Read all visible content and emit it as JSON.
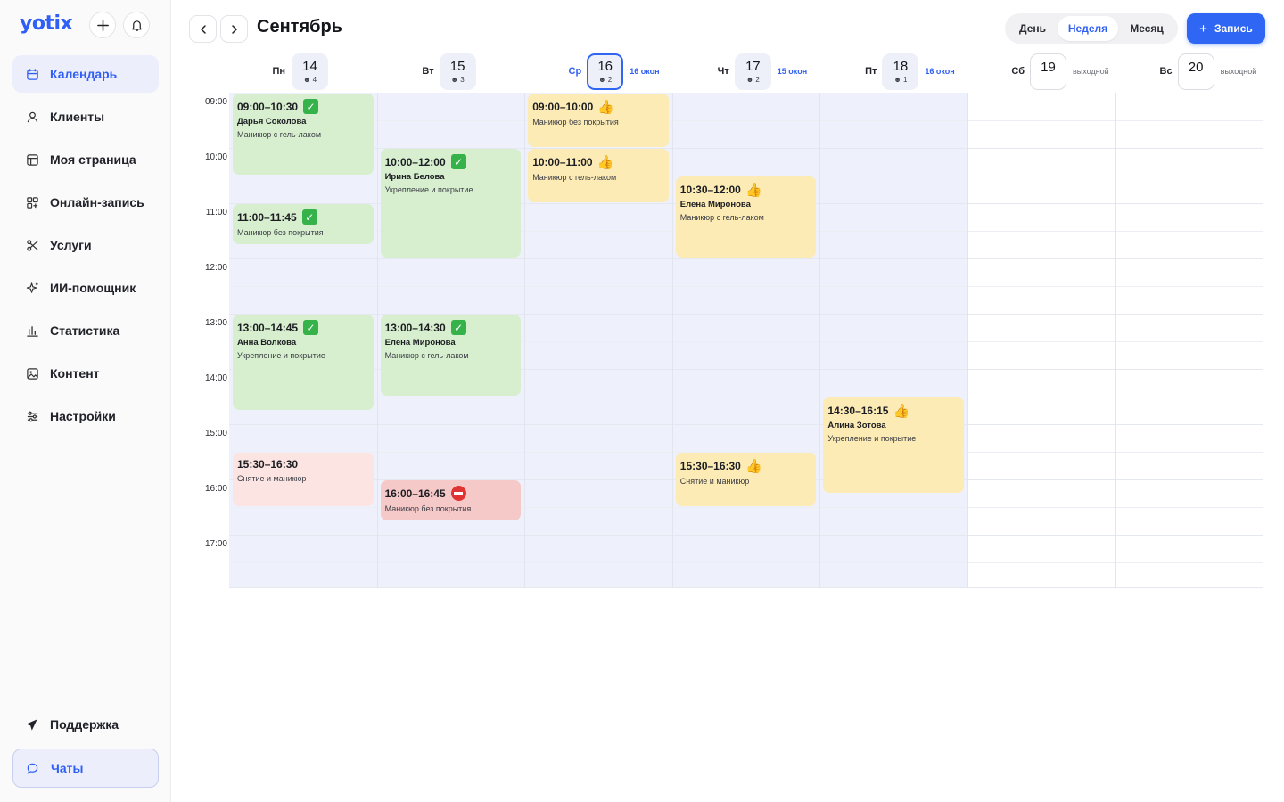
{
  "app": {
    "logo": "yotix"
  },
  "sidebar": {
    "items": [
      {
        "label": "Календарь",
        "icon": "calendar-icon",
        "active": true
      },
      {
        "label": "Клиенты",
        "icon": "person-icon"
      },
      {
        "label": "Моя страница",
        "icon": "page-icon"
      },
      {
        "label": "Онлайн-запись",
        "icon": "grid-plus-icon"
      },
      {
        "label": "Услуги",
        "icon": "scissors-icon"
      },
      {
        "label": "ИИ-помощник",
        "icon": "sparkle-icon"
      },
      {
        "label": "Статистика",
        "icon": "bar-chart-icon"
      },
      {
        "label": "Контент",
        "icon": "image-icon"
      },
      {
        "label": "Настройки",
        "icon": "sliders-icon"
      }
    ],
    "support": "Поддержка",
    "chats": "Чаты"
  },
  "header": {
    "month": "Сентябрь",
    "views": [
      "День",
      "Неделя",
      "Месяц"
    ],
    "active_view": "Неделя",
    "add_label": "Запись"
  },
  "days": [
    {
      "name": "Пн",
      "date": "14",
      "count": "4",
      "extra": ""
    },
    {
      "name": "Вт",
      "date": "15",
      "count": "3",
      "extra": ""
    },
    {
      "name": "Ср",
      "date": "16",
      "count": "2",
      "extra": "16 окон",
      "today": true
    },
    {
      "name": "Чт",
      "date": "17",
      "count": "2",
      "extra": "15 окон"
    },
    {
      "name": "Пт",
      "date": "18",
      "count": "1",
      "extra": "16 окон"
    },
    {
      "name": "Сб",
      "date": "19",
      "count": "",
      "extra": "выходной",
      "off": true
    },
    {
      "name": "Вс",
      "date": "20",
      "count": "",
      "extra": "выходной",
      "off": true
    }
  ],
  "times": [
    "09:00",
    "10:00",
    "11:00",
    "12:00",
    "13:00",
    "14:00",
    "15:00",
    "16:00",
    "17:00"
  ],
  "events": [
    {
      "day": 0,
      "start": "09:00",
      "end": "10:30",
      "time": "09:00–10:30",
      "status": "confirmed",
      "client": "Дарья Соколова",
      "service": "Маникюр с гель-лаком",
      "color": "green"
    },
    {
      "day": 0,
      "start": "11:00",
      "end": "11:45",
      "time": "11:00–11:45",
      "status": "confirmed",
      "client": "",
      "service": "Маникюр без покрытия",
      "color": "green"
    },
    {
      "day": 0,
      "start": "13:00",
      "end": "14:45",
      "time": "13:00–14:45",
      "status": "confirmed",
      "client": "Анна Волкова",
      "service": "Укрепление и покрытие",
      "color": "green"
    },
    {
      "day": 0,
      "start": "15:30",
      "end": "16:30",
      "time": "15:30–16:30",
      "status": "none",
      "client": "",
      "service": "Снятие и маникюр",
      "color": "pink"
    },
    {
      "day": 1,
      "start": "10:00",
      "end": "12:00",
      "time": "10:00–12:00",
      "status": "confirmed",
      "client": "Ирина Белова",
      "service": "Укрепление и покрытие",
      "color": "green"
    },
    {
      "day": 1,
      "start": "13:00",
      "end": "14:30",
      "time": "13:00–14:30",
      "status": "confirmed",
      "client": "Елена Миронова",
      "service": "Маникюр с гель-лаком",
      "color": "green"
    },
    {
      "day": 1,
      "start": "16:00",
      "end": "16:45",
      "time": "16:00–16:45",
      "status": "cancelled",
      "client": "",
      "service": "Маникюр без покрытия",
      "color": "red"
    },
    {
      "day": 2,
      "start": "09:00",
      "end": "10:00",
      "time": "09:00–10:00",
      "status": "liked",
      "client": "",
      "service": "Маникюр без покрытия",
      "color": "yellow"
    },
    {
      "day": 2,
      "start": "10:00",
      "end": "11:00",
      "time": "10:00–11:00",
      "status": "liked",
      "client": "",
      "service": "Маникюр с гель-лаком",
      "color": "yellow"
    },
    {
      "day": 3,
      "start": "10:30",
      "end": "12:00",
      "time": "10:30–12:00",
      "status": "liked",
      "client": "Елена Миронова",
      "service": "Маникюр с гель-лаком",
      "color": "yellow"
    },
    {
      "day": 3,
      "start": "15:30",
      "end": "16:30",
      "time": "15:30–16:30",
      "status": "liked",
      "client": "",
      "service": "Снятие и маникюр",
      "color": "yellow"
    },
    {
      "day": 4,
      "start": "14:30",
      "end": "16:15",
      "time": "14:30–16:15",
      "status": "liked",
      "client": "Алина Зотова",
      "service": "Укрепление и покрытие",
      "color": "yellow"
    }
  ]
}
